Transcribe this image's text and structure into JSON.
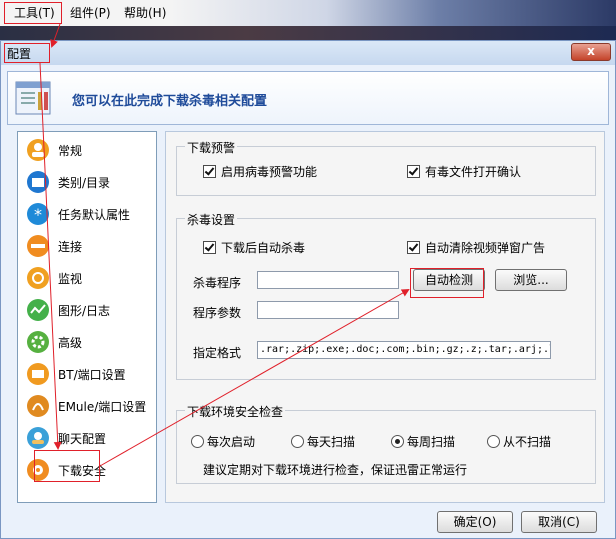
{
  "menu": {
    "tools": "工具(T)",
    "components": "组件(P)",
    "help": "帮助(H)"
  },
  "dialog": {
    "title": "配置",
    "close": "x",
    "banner": "您可以在此完成下载杀毒相关配置"
  },
  "sidebar": {
    "items": [
      {
        "label": "常规",
        "icon": "general-icon",
        "color": "#f0a020"
      },
      {
        "label": "类别/目录",
        "icon": "folder-icon",
        "color": "#1f77d0"
      },
      {
        "label": "任务默认属性",
        "icon": "asterisk-icon",
        "color": "#1f8ad8"
      },
      {
        "label": "连接",
        "icon": "connection-icon",
        "color": "#f08c20"
      },
      {
        "label": "监视",
        "icon": "monitor-icon",
        "color": "#f0a020"
      },
      {
        "label": "图形/日志",
        "icon": "graph-icon",
        "color": "#44b04a"
      },
      {
        "label": "高级",
        "icon": "gear-icon",
        "color": "#56b040"
      },
      {
        "label": "BT/端口设置",
        "icon": "bt-icon",
        "color": "#f09a20"
      },
      {
        "label": "EMule/端口设置",
        "icon": "emule-icon",
        "color": "#e08a20"
      },
      {
        "label": "聊天配置",
        "icon": "chat-icon",
        "color": "#3aa0d8"
      },
      {
        "label": "下载安全",
        "icon": "shield-icon",
        "color": "#f08c20"
      }
    ]
  },
  "download_warning": {
    "legend": "下载预警",
    "enable_virus_warning": "启用病毒预警功能",
    "confirm_open_virus_file": "有毒文件打开确认"
  },
  "antivirus": {
    "legend": "杀毒设置",
    "auto_scan_after_download": "下载后自动杀毒",
    "auto_clear_popup_ads": "自动清除视频弹窗广告",
    "program_label": "杀毒程序",
    "program_value": "",
    "params_label": "程序参数",
    "params_value": "",
    "auto_detect_button": "自动检测",
    "browse_button": "浏览...",
    "formats_label": "指定格式",
    "formats_value": ".rar;.zip;.exe;.doc;.com;.bin;.gz;.z;.tar;.arj;.l"
  },
  "env_check": {
    "legend": "下载环境安全检查",
    "options": [
      "每次启动",
      "每天扫描",
      "每周扫描",
      "从不扫描"
    ],
    "selected": "每周扫描",
    "hint": "建议定期对下载环境进行检查，保证迅雷正常运行"
  },
  "footer": {
    "ok": "确定(O)",
    "cancel": "取消(C)"
  }
}
